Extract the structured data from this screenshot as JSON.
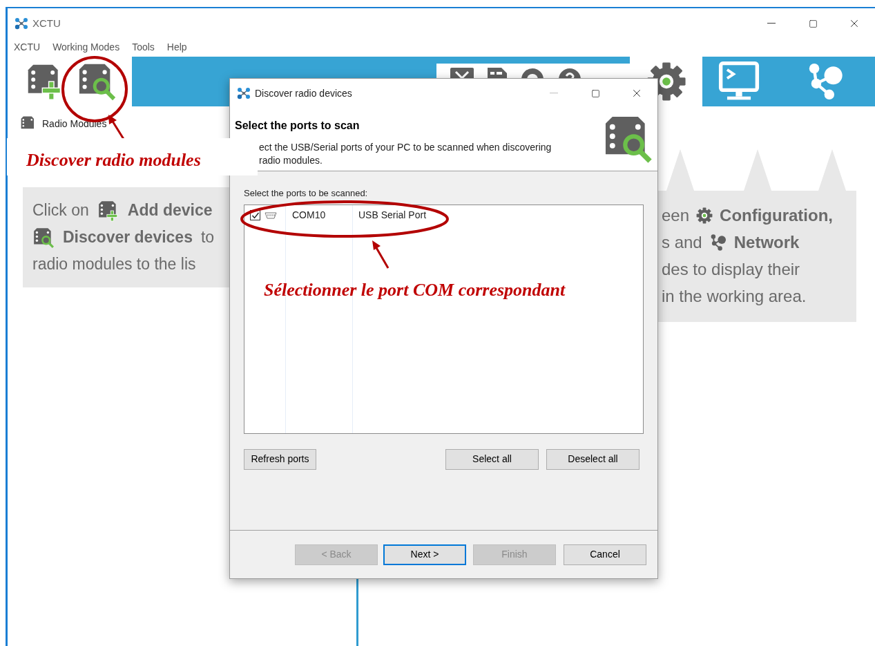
{
  "window": {
    "title": "XCTU"
  },
  "menu": [
    "XCTU",
    "Working Modes",
    "Tools",
    "Help"
  ],
  "working_modes": [
    {
      "kind": "configuration",
      "selected": true
    },
    {
      "kind": "consoles",
      "selected": false
    },
    {
      "kind": "network",
      "selected": false
    }
  ],
  "sidebar": {
    "title": "Radio Modules"
  },
  "left_hint": [
    [
      {
        "kind": "text",
        "text": "Click on"
      },
      {
        "kind": "add"
      },
      {
        "kind": "bold",
        "text": "Add device"
      }
    ],
    [
      {
        "kind": "discover"
      },
      {
        "kind": "bold",
        "text": "Discover devices"
      },
      {
        "kind": "text",
        "text": "to"
      }
    ],
    [
      {
        "kind": "text",
        "text": "radio modules to the lis"
      }
    ]
  ],
  "right_hint": [
    [
      {
        "kind": "text",
        "text": "een"
      },
      {
        "kind": "gear"
      },
      {
        "kind": "bold",
        "text": "Configuration,"
      }
    ],
    [
      {
        "kind": "text",
        "text": "s and"
      },
      {
        "kind": "network"
      },
      {
        "kind": "bold",
        "text": "Network"
      }
    ],
    [
      {
        "kind": "text",
        "text": "des to display their"
      }
    ],
    [
      {
        "kind": "text",
        "text": "in the working area."
      }
    ]
  ],
  "dialog": {
    "title": "Discover radio devices",
    "minimize_disabled": true,
    "header": "Select the ports to scan",
    "description": [
      "ect the USB/Serial ports of your PC to be scanned when discovering",
      "radio modules."
    ],
    "list_label": "Select the ports to be scanned:",
    "ports": [
      {
        "checked": true,
        "name": "COM10",
        "description": "USB Serial Port"
      }
    ],
    "list_buttons": [
      "Refresh ports",
      "Select all",
      "Deselect all"
    ],
    "nav_buttons": [
      {
        "label": "< Back",
        "disabled": true,
        "default": false
      },
      {
        "label": "Next >",
        "disabled": false,
        "default": true
      },
      {
        "label": "Finish",
        "disabled": true,
        "default": false
      },
      {
        "label": "Cancel",
        "disabled": false,
        "default": false
      }
    ]
  },
  "annotations": [
    {
      "text": "Discover radio modules"
    },
    {
      "text": "Sélectionner le port COM correspondant"
    }
  ]
}
